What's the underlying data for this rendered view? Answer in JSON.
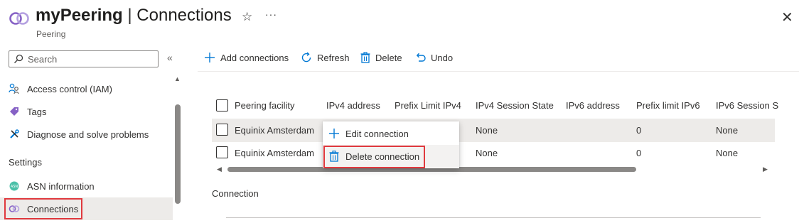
{
  "header": {
    "resource_name": "myPeering",
    "separator": "|",
    "page_name": "Connections",
    "subtitle": "Peering",
    "icons": {
      "resource": "peering-link-icon",
      "favorite": "star-icon",
      "more": "ellipsis-icon",
      "close": "close-icon"
    }
  },
  "sidebar": {
    "search_placeholder": "Search",
    "collapse_glyph": "«",
    "items": [
      {
        "label": "Access control (IAM)",
        "icon": "people-icon"
      },
      {
        "label": "Tags",
        "icon": "tag-icon"
      },
      {
        "label": "Diagnose and solve problems",
        "icon": "wrench-icon"
      }
    ],
    "settings_header": "Settings",
    "settings_items": [
      {
        "label": "ASN information",
        "icon": "asn-icon"
      },
      {
        "label": "Connections",
        "icon": "peering-link-icon",
        "selected": true
      }
    ]
  },
  "toolbar": {
    "add_label": "Add connections",
    "refresh_label": "Refresh",
    "delete_label": "Delete",
    "undo_label": "Undo"
  },
  "grid": {
    "columns": [
      "Peering facility",
      "IPv4 address",
      "Prefix Limit IPv4",
      "IPv4 Session State",
      "IPv6 address",
      "Prefix limit IPv6",
      "IPv6 Session S"
    ],
    "rows": [
      {
        "facility": "Equinix Amsterdam",
        "ipv4_state": "None",
        "prefix_v6": "0",
        "ipv6_state": "None"
      },
      {
        "facility": "Equinix Amsterdam",
        "ipv4_state": "None",
        "prefix_v6": "0",
        "ipv6_state": "None"
      }
    ]
  },
  "context_menu": {
    "edit_label": "Edit connection",
    "delete_label": "Delete connection"
  },
  "details": {
    "section_label": "Connection"
  },
  "colors": {
    "accent": "#0078d4",
    "highlight_border": "#e0393e",
    "peering_icon": "#8661c5"
  }
}
